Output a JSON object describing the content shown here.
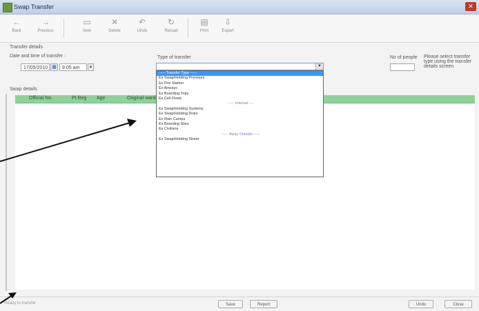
{
  "window": {
    "title": "Swap Transfer",
    "close_label": "✕"
  },
  "toolbar": [
    {
      "icon": "back-icon",
      "glyph": "←",
      "label": "Back"
    },
    {
      "icon": "forward-icon",
      "glyph": "→",
      "label": "Previous"
    },
    {
      "icon": "new-icon",
      "glyph": "▭",
      "label": "New"
    },
    {
      "icon": "delete-icon",
      "glyph": "✕",
      "label": "Delete"
    },
    {
      "icon": "undo-icon",
      "glyph": "↶",
      "label": "Undo"
    },
    {
      "icon": "refresh-icon",
      "glyph": "↻",
      "label": "Reload"
    },
    {
      "icon": "print-icon",
      "glyph": "▤",
      "label": "Print"
    },
    {
      "icon": "export-icon",
      "glyph": "⇩",
      "label": "Export"
    }
  ],
  "transfer_details": {
    "section_title": "Transfer details",
    "date_label": "Date and time of transfer :",
    "date_value": "17/05/2010",
    "time_value": "9:05 am",
    "type_label": "Type of transfer",
    "no_of_people_label": "No of people",
    "no_of_people_value": "",
    "note": "Please select transfer type using the transfer details screen"
  },
  "dropdown_options": [
    {
      "text": "----- Transfer Type -----",
      "kind": "sel"
    },
    {
      "text": "Ex Swap/Holding Premises",
      "kind": "opt"
    },
    {
      "text": "Ex Fire Station",
      "kind": "opt"
    },
    {
      "text": "Ex Airways",
      "kind": "opt"
    },
    {
      "text": "Ex Boarding Trips",
      "kind": "opt"
    },
    {
      "text": "Ex Cell Flows",
      "kind": "opt"
    },
    {
      "text": "----- Internal ----",
      "kind": "cat"
    },
    {
      "text": "Ex Swap/Holding Systems",
      "kind": "opt"
    },
    {
      "text": "Ex Swap/Holding Drain",
      "kind": "opt"
    },
    {
      "text": "Ex Rain Camps",
      "kind": "opt"
    },
    {
      "text": "Ex Boarding Sites",
      "kind": "opt"
    },
    {
      "text": "Ex Civilians",
      "kind": "opt"
    },
    {
      "text": "----- Away Outside -----",
      "kind": "cat"
    },
    {
      "text": "Ex Swap/Holding Street",
      "kind": "opt"
    }
  ],
  "grid": {
    "section_title": "Swap details",
    "columns": [
      "Official No.",
      "Pt Reg",
      "Age",
      "Original ward"
    ]
  },
  "bottom": {
    "status": "Ready to transfer",
    "buttons": [
      "Save",
      "Report",
      "Undo",
      "Close"
    ]
  },
  "colors": {
    "grid_header": "#8fd19a",
    "selection": "#3399ff"
  }
}
